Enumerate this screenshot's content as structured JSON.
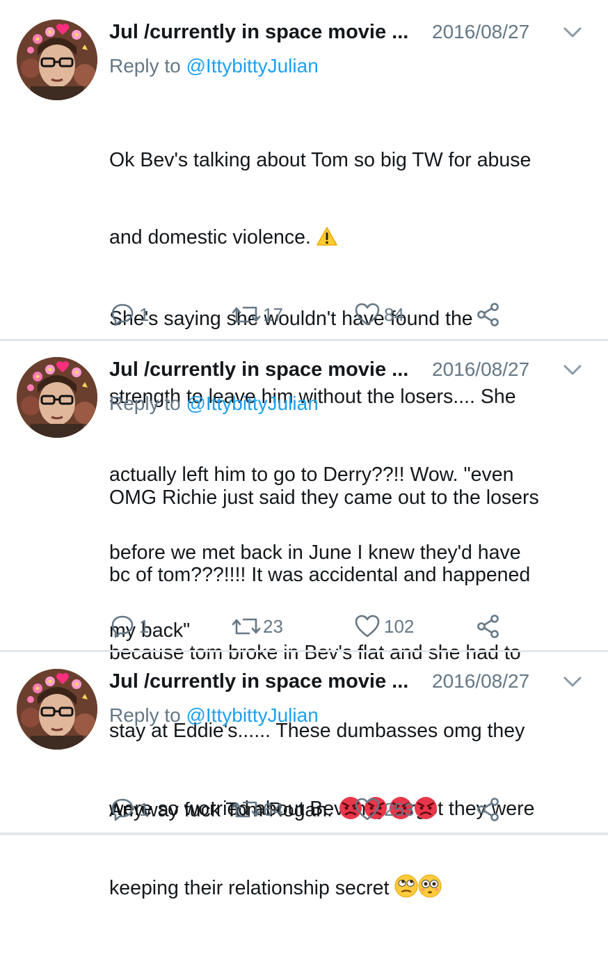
{
  "tweets": [
    {
      "author": "Jul /currently in space movie ...",
      "date": "2016/08/27",
      "reply_prefix": "Reply to ",
      "reply_handle": "@IttybittyJulian",
      "lines": [
        "Ok Bev's talking about Tom so big TW for abuse",
        "and domestic violence. ",
        "She's saying she wouldn't have found the",
        "strength to leave him without the losers.... She",
        "actually left him to go to Derry??!! Wow. \"even",
        "before we met back in June I knew they'd have",
        "my back\""
      ],
      "reply_count": "1",
      "retweet_count": "17",
      "like_count": "84"
    },
    {
      "author": "Jul /currently in space movie ...",
      "date": "2016/08/27",
      "reply_prefix": "Reply to ",
      "reply_handle": "@IttybittyJulian",
      "lines": [
        "OMG Richie just said they came out to the losers",
        "bc of tom???!!!! It was accidental and happened",
        "because tom broke in Bev's flat and she had to",
        "stay at Eddie's...... These dumbasses omg they",
        "were so worried about Bev they forgot they were",
        "keeping their relationship secret "
      ],
      "reply_count": "1",
      "retweet_count": "23",
      "like_count": "102"
    },
    {
      "author": "Jul /currently in space movie ...",
      "date": "2016/08/27",
      "reply_prefix": "Reply to ",
      "reply_handle": "@IttybittyJulian",
      "lines": [
        "Anyway fuck Tom Rogan. "
      ],
      "reply_count": "1",
      "retweet_count": "64",
      "like_count": "253"
    }
  ],
  "icons": {
    "warning": "warning-emoji",
    "eye_roll": "eye-roll-emoji",
    "flushed": "flushed-emoji",
    "angry": "angry-emoji",
    "reply": "reply-icon",
    "retweet": "retweet-icon",
    "like": "heart-icon",
    "share": "share-icon",
    "more": "chevron-down-icon"
  },
  "colors": {
    "link": "#1da1f2",
    "secondary": "#657786",
    "divider": "#e1e8ed"
  }
}
